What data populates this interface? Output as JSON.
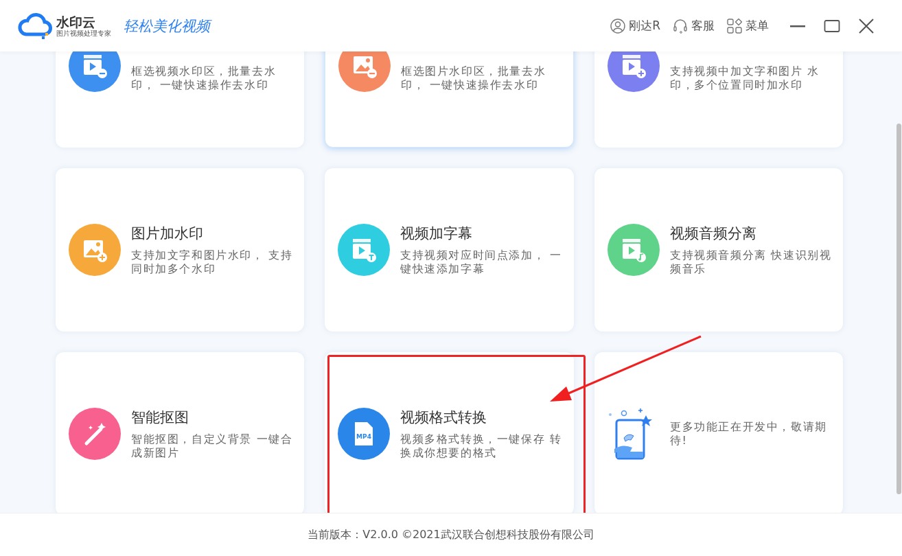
{
  "header": {
    "logo_name": "水印云",
    "logo_tagline": "图片视频处理专家",
    "slogan": "轻松美化视频",
    "user": "刚达R",
    "service": "客服",
    "menu": "菜单"
  },
  "cards": [
    {
      "kind": "video-minus",
      "color": "#3d8ff0",
      "description": "框选视频水印区，批量去水印， 一键快速操作去水印",
      "highlighted": false,
      "annotated": false
    },
    {
      "kind": "image-minus",
      "color": "#f58a62",
      "description": "框选图片水印区，批量去水印， 一键快速操作去水印",
      "highlighted": true,
      "annotated": false
    },
    {
      "kind": "video-plus",
      "color": "#7b7ff0",
      "description": "支持视频中加文字和图片 水印，多个位置同时加水印",
      "highlighted": false,
      "annotated": false
    },
    {
      "kind": "image-plus",
      "color": "#f6a93a",
      "title": "图片加水印",
      "description": "支持加文字和图片水印， 支持同时加多个水印",
      "highlighted": false,
      "annotated": false
    },
    {
      "kind": "video-subtitle",
      "color": "#2fcde0",
      "title": "视频加字幕",
      "description": "支持视频对应时间点添加， 一键快速添加字幕",
      "highlighted": false,
      "annotated": false
    },
    {
      "kind": "video-music",
      "color": "#5fd38a",
      "title": "视频音频分离",
      "description": "支持视频音频分离 快速识别视频音乐",
      "highlighted": false,
      "annotated": false
    },
    {
      "kind": "magic-wand",
      "color": "#f7608f",
      "title": "智能抠图",
      "description": "智能抠图，自定义背景 一键合成新图片",
      "highlighted": false,
      "annotated": false
    },
    {
      "kind": "file",
      "color": "#2a86e8",
      "badge": "MP4",
      "title": "视频格式转换",
      "description": "视频多格式转换，一键保存 转换成你想要的格式",
      "highlighted": false,
      "annotated": true
    },
    {
      "kind": "robot",
      "color": "#2f7ff0",
      "description": "更多功能正在开发中，敬请期待!",
      "highlighted": false,
      "annotated": false
    }
  ],
  "footer": "当前版本：V2.0.0 ©2021武汉联合创想科技股份有限公司"
}
